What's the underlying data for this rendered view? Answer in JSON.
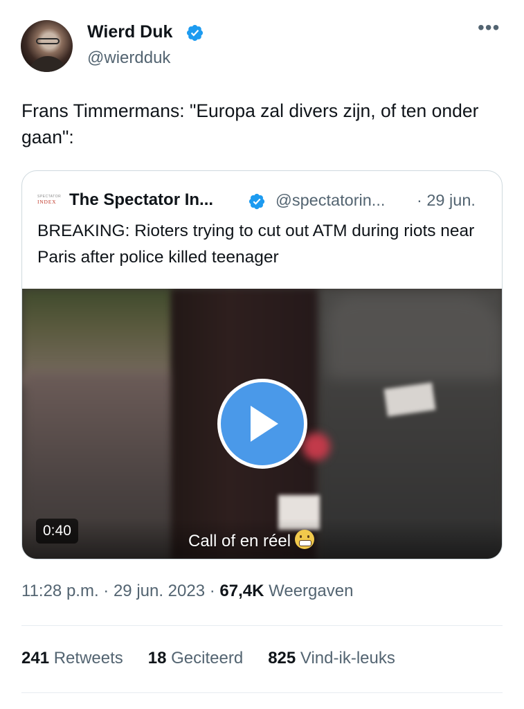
{
  "author": {
    "name": "Wierd Duk",
    "handle": "@wierdduk",
    "verified": true,
    "avatar_icon": "profile-photo"
  },
  "more_label": "•••",
  "tweet": {
    "text": "Frans Timmermans: \"Europa zal divers zijn, of ten onder gaan\":"
  },
  "quote": {
    "logo_line1": "SPECTATOR",
    "logo_line2": "INDEX",
    "name": "The Spectator In...",
    "handle": "@spectatorin...",
    "date": "· 29 jun.",
    "text": "BREAKING: Rioters trying to cut out ATM during riots near Paris after police killed teenager",
    "video": {
      "duration": "0:40",
      "caption": "Call of en réel"
    }
  },
  "meta": {
    "time": "11:28 p.m. · 29 jun. 2023 · ",
    "views": "67,4K",
    "views_label": " Weergaven"
  },
  "stats": {
    "retweets": "241",
    "retweets_label": " Retweets",
    "quotes": "18",
    "quotes_label": " Geciteerd",
    "likes": "825",
    "likes_label": " Vind-ik-leuks"
  },
  "colors": {
    "verified_blue": "#1d9bf0",
    "play_blue": "#4a99e9",
    "text": "#0f1419",
    "muted": "#536471",
    "border": "#cfd9de"
  }
}
